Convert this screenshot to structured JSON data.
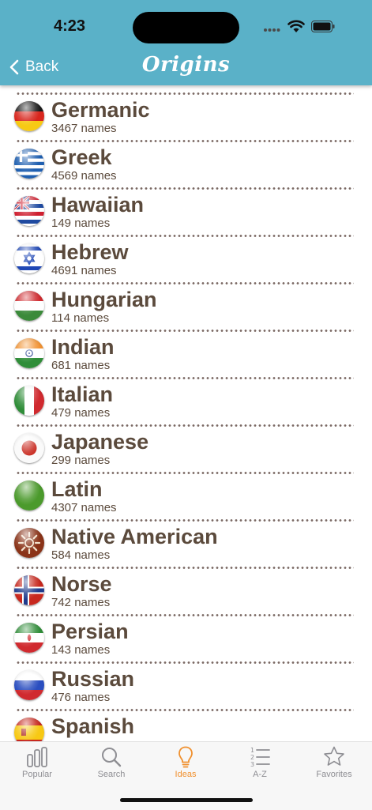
{
  "status_bar": {
    "time": "4:23"
  },
  "nav": {
    "back_label": "Back",
    "title": "Origins"
  },
  "origins": [
    {
      "name": "Germanic",
      "count": "3467 names",
      "flag": "germany-flag-icon"
    },
    {
      "name": "Greek",
      "count": "4569 names",
      "flag": "greece-flag-icon"
    },
    {
      "name": "Hawaiian",
      "count": "149 names",
      "flag": "hawaii-flag-icon"
    },
    {
      "name": "Hebrew",
      "count": "4691 names",
      "flag": "israel-flag-icon"
    },
    {
      "name": "Hungarian",
      "count": "114 names",
      "flag": "hungary-flag-icon"
    },
    {
      "name": "Indian",
      "count": "681 names",
      "flag": "india-flag-icon"
    },
    {
      "name": "Italian",
      "count": "479 names",
      "flag": "italy-flag-icon"
    },
    {
      "name": "Japanese",
      "count": "299 names",
      "flag": "japan-flag-icon"
    },
    {
      "name": "Latin",
      "count": "4307 names",
      "flag": "latin-green-icon"
    },
    {
      "name": "Native American",
      "count": "584 names",
      "flag": "native-american-sun-icon"
    },
    {
      "name": "Norse",
      "count": "742 names",
      "flag": "norway-flag-icon"
    },
    {
      "name": "Persian",
      "count": "143 names",
      "flag": "iran-flag-icon"
    },
    {
      "name": "Russian",
      "count": "476 names",
      "flag": "russia-flag-icon"
    },
    {
      "name": "Spanish",
      "count": "",
      "flag": "spain-flag-icon"
    }
  ],
  "tabs": [
    {
      "label": "Popular",
      "icon": "bar-chart-icon",
      "active": false
    },
    {
      "label": "Search",
      "icon": "search-icon",
      "active": false
    },
    {
      "label": "Ideas",
      "icon": "lightbulb-icon",
      "active": true
    },
    {
      "label": "A-Z",
      "icon": "numbered-list-icon",
      "active": false
    },
    {
      "label": "Favorites",
      "icon": "star-icon",
      "active": false
    }
  ],
  "colors": {
    "header": "#5ab1c8",
    "text": "#5b4a3c",
    "active_tab": "#f0902e",
    "inactive_tab": "#8e8e93"
  }
}
